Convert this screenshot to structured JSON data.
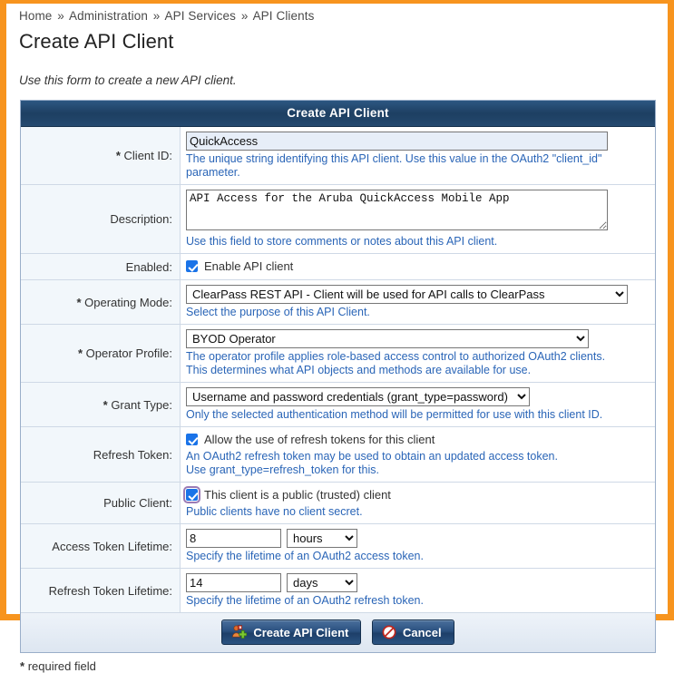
{
  "breadcrumb": {
    "items": [
      "Home",
      "Administration",
      "API Services",
      "API Clients"
    ],
    "separator": "»"
  },
  "page": {
    "title": "Create API Client",
    "intro": "Use this form to create a new API client.",
    "required_note_star": "*",
    "required_note_text": "required field"
  },
  "form": {
    "header": "Create API Client",
    "fields": {
      "client_id": {
        "label": "Client ID:",
        "required": true,
        "value": "QuickAccess",
        "hint": "The unique string identifying this API client. Use this value in the OAuth2 \"client_id\" parameter."
      },
      "description": {
        "label": "Description:",
        "required": false,
        "value": "API Access for the Aruba QuickAccess Mobile App",
        "hint": "Use this field to store comments or notes about this API client."
      },
      "enabled": {
        "label": "Enabled:",
        "required": false,
        "checkbox_label": "Enable API client",
        "checked": true
      },
      "operating_mode": {
        "label": "Operating Mode:",
        "required": true,
        "value": "ClearPass REST API - Client will be used for API calls to ClearPass",
        "hint": "Select the purpose of this API Client."
      },
      "operator_profile": {
        "label": "Operator Profile:",
        "required": true,
        "value": "BYOD Operator",
        "hint": "The operator profile applies role-based access control to authorized OAuth2 clients.",
        "hint2": "This determines what API objects and methods are available for use."
      },
      "grant_type": {
        "label": "Grant Type:",
        "required": true,
        "value": "Username and password credentials (grant_type=password)",
        "hint": "Only the selected authentication method will be permitted for use with this client ID."
      },
      "refresh_token": {
        "label": "Refresh Token:",
        "required": false,
        "checkbox_label": "Allow the use of refresh tokens for this client",
        "checked": true,
        "hint": "An OAuth2 refresh token may be used to obtain an updated access token.",
        "hint2": "Use grant_type=refresh_token for this."
      },
      "public_client": {
        "label": "Public Client:",
        "required": false,
        "checkbox_label": "This client is a public (trusted) client",
        "checked": true,
        "focused": true,
        "hint": "Public clients have no client secret."
      },
      "access_token_lifetime": {
        "label": "Access Token Lifetime:",
        "required": false,
        "value": "8",
        "unit": "hours",
        "hint": "Specify the lifetime of an OAuth2 access token."
      },
      "refresh_token_lifetime": {
        "label": "Refresh Token Lifetime:",
        "required": false,
        "value": "14",
        "unit": "days",
        "hint": "Specify the lifetime of an OAuth2 refresh token."
      }
    },
    "buttons": {
      "submit": {
        "label": "Create API Client",
        "icon": "add-user-icon"
      },
      "cancel": {
        "label": "Cancel",
        "icon": "no-entry-icon"
      }
    }
  },
  "colors": {
    "page_border": "#f7941e",
    "panel_header": "#24496f",
    "hint_text": "#2a65b7",
    "checkbox": "#1a73e8",
    "button": "#2b5180"
  }
}
